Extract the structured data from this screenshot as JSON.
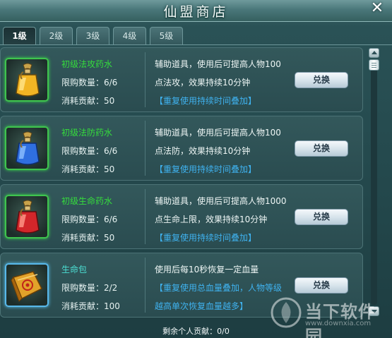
{
  "window": {
    "title": "仙盟商店",
    "close_symbol": "✕"
  },
  "tabs": [
    {
      "label": "1级",
      "active": true
    },
    {
      "label": "2级",
      "active": false
    },
    {
      "label": "3级",
      "active": false
    },
    {
      "label": "4级",
      "active": false
    },
    {
      "label": "5级",
      "active": false
    }
  ],
  "items": [
    {
      "name": "初级法攻药水",
      "limit": "限购数量：6/6",
      "cost": "消耗贡献：50",
      "desc1": "辅助道具，使用后可提高人物100",
      "desc2": "点法攻，效果持续10分钟",
      "desc3": "【重复使用持续时间叠加】",
      "button": "兑换",
      "icon": "yellow-potion-icon"
    },
    {
      "name": "初级法防药水",
      "limit": "限购数量：6/6",
      "cost": "消耗贡献：50",
      "desc1": "辅助道具，使用后可提高人物100",
      "desc2": "点法防，效果持续10分钟",
      "desc3": "【重复使用持续时间叠加】",
      "button": "兑换",
      "icon": "blue-potion-icon"
    },
    {
      "name": "初级生命药水",
      "limit": "限购数量：6/6",
      "cost": "消耗贡献：50",
      "desc1": "辅助道具，使用后可提高人物1000",
      "desc2": "点生命上限，效果持续10分钟",
      "desc3": "【重复使用持续时间叠加】",
      "button": "兑换",
      "icon": "red-potion-icon"
    },
    {
      "name": "生命包",
      "limit": "限购数量：2/2",
      "cost": "消耗贡献：100",
      "desc1": "使用后每10秒恢复一定血量",
      "desc2": "【重复使用总血量叠加，人物等级",
      "desc3": "越高单次恢复血量越多】",
      "button": "兑换",
      "icon": "life-pack-icon"
    }
  ],
  "footer": {
    "remaining": "剩余个人贡献：0/0"
  },
  "watermark": {
    "brand": "当下软件园",
    "url": "www.downxia.com"
  },
  "colors": {
    "item_name": "#35dc3c",
    "item_name_special": "#4ce0d4",
    "note_blue": "#3fb2ef",
    "slot_border_green": "#3fc44e",
    "slot_border_blue": "#58b8ea"
  }
}
